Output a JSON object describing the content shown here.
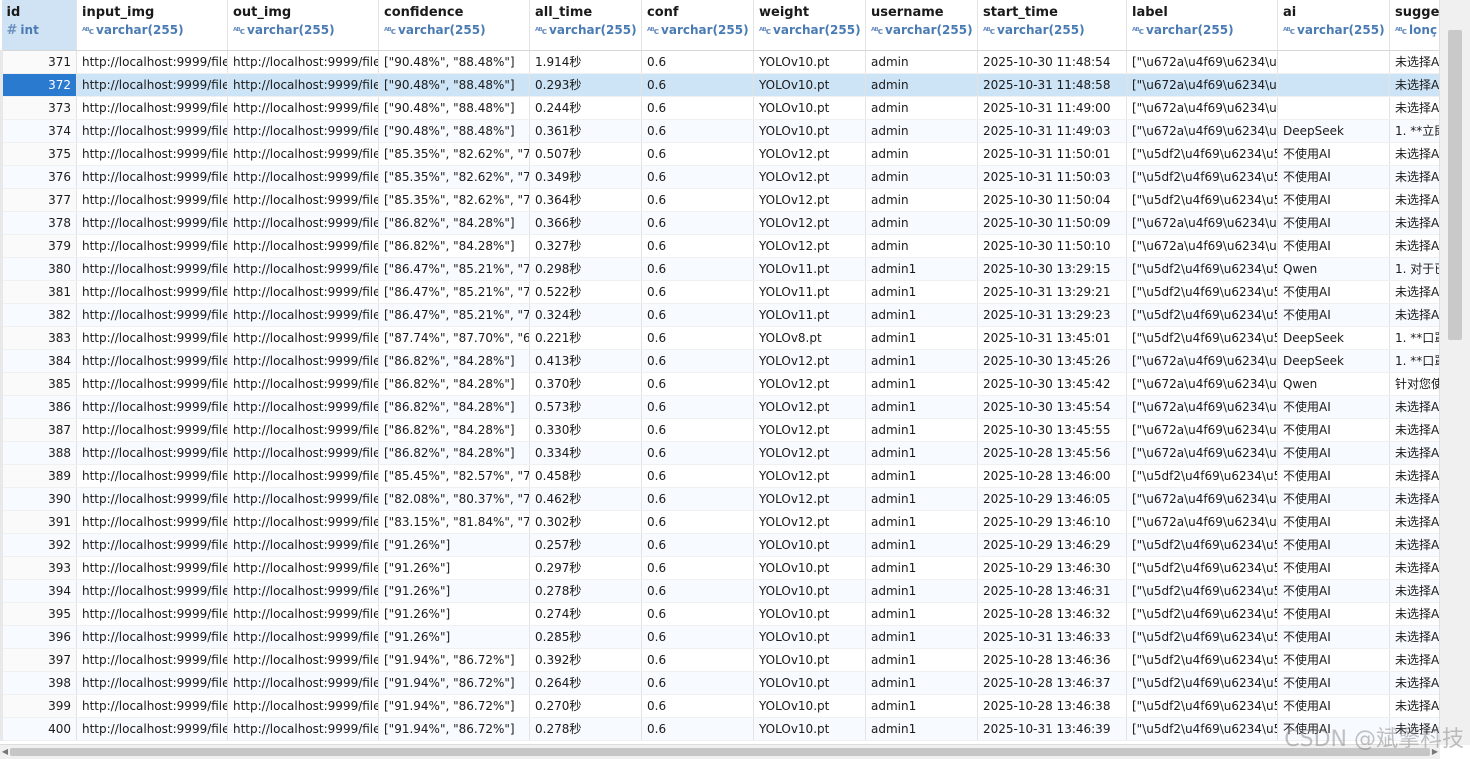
{
  "columns": [
    {
      "name": "id",
      "type": "int",
      "icon": "number-type-icon"
    },
    {
      "name": "input_img",
      "type": "",
      "icon": ""
    },
    {
      "name": "out_img",
      "type": "varchar(255)",
      "icon": "text-type-icon"
    },
    {
      "name": "confidence",
      "type": "varchar(255)",
      "icon": "text-type-icon"
    },
    {
      "name": "all_time",
      "type": "varchar(255)",
      "icon": "text-type-icon"
    },
    {
      "name": "conf",
      "type": "varchar(255)",
      "icon": "text-type-icon"
    },
    {
      "name": "weight",
      "type": "varchar(255)",
      "icon": "text-type-icon"
    },
    {
      "name": "username",
      "type": "varchar(255)",
      "icon": "text-type-icon"
    },
    {
      "name": "start_time",
      "type": "varchar(255)",
      "icon": "text-type-icon"
    },
    {
      "name": "label",
      "type": "varchar(255)",
      "icon": "text-type-icon"
    },
    {
      "name": "ai",
      "type": "varchar(255)",
      "icon": "text-type-icon"
    },
    {
      "name": "sugge",
      "type": "lonç",
      "icon": "text-type-icon"
    }
  ],
  "input_img_type": "varchar(255)",
  "rows": [
    [
      "371",
      "http://localhost:9999/file",
      "http://localhost:9999/file",
      "[\"90.48%\", \"88.48%\"]",
      "1.914秒",
      "0.6",
      "YOLOv10.pt",
      "admin",
      "2025-10-30 11:48:54",
      "[\"\\u672a\\u4f69\\u6234\\u5",
      "",
      "未选择A"
    ],
    [
      "372",
      "http://localhost:9999/file",
      "http://localhost:9999/file",
      "[\"90.48%\", \"88.48%\"]",
      "0.293秒",
      "0.6",
      "YOLOv10.pt",
      "admin",
      "2025-10-31 11:48:58",
      "[\"\\u672a\\u4f69\\u6234\\u5",
      "",
      "未选择A"
    ],
    [
      "373",
      "http://localhost:9999/file",
      "http://localhost:9999/file",
      "[\"90.48%\", \"88.48%\"]",
      "0.244秒",
      "0.6",
      "YOLOv10.pt",
      "admin",
      "2025-10-31 11:49:00",
      "[\"\\u672a\\u4f69\\u6234\\u5",
      "",
      "未选择A"
    ],
    [
      "374",
      "http://localhost:9999/file",
      "http://localhost:9999/file",
      "[\"90.48%\", \"88.48%\"]",
      "0.361秒",
      "0.6",
      "YOLOv10.pt",
      "admin",
      "2025-10-31 11:49:03",
      "[\"\\u672a\\u4f69\\u6234\\u5",
      "DeepSeek",
      "1. **立即"
    ],
    [
      "375",
      "http://localhost:9999/file",
      "http://localhost:9999/file",
      "[\"85.35%\", \"82.62%\", \"71",
      "0.507秒",
      "0.6",
      "YOLOv12.pt",
      "admin",
      "2025-10-31 11:50:01",
      "[\"\\u5df2\\u4f69\\u6234\\u5",
      "不使用AI",
      "未选择A"
    ],
    [
      "376",
      "http://localhost:9999/file",
      "http://localhost:9999/file",
      "[\"85.35%\", \"82.62%\", \"71",
      "0.349秒",
      "0.6",
      "YOLOv12.pt",
      "admin",
      "2025-10-31 11:50:03",
      "[\"\\u5df2\\u4f69\\u6234\\u5",
      "不使用AI",
      "未选择A"
    ],
    [
      "377",
      "http://localhost:9999/file",
      "http://localhost:9999/file",
      "[\"85.35%\", \"82.62%\", \"71",
      "0.364秒",
      "0.6",
      "YOLOv12.pt",
      "admin",
      "2025-10-30 11:50:04",
      "[\"\\u5df2\\u4f69\\u6234\\u5",
      "不使用AI",
      "未选择A"
    ],
    [
      "378",
      "http://localhost:9999/file",
      "http://localhost:9999/file",
      "[\"86.82%\", \"84.28%\"]",
      "0.366秒",
      "0.6",
      "YOLOv12.pt",
      "admin",
      "2025-10-30 11:50:09",
      "[\"\\u672a\\u4f69\\u6234\\u5",
      "不使用AI",
      "未选择A"
    ],
    [
      "379",
      "http://localhost:9999/file",
      "http://localhost:9999/file",
      "[\"86.82%\", \"84.28%\"]",
      "0.327秒",
      "0.6",
      "YOLOv12.pt",
      "admin",
      "2025-10-30 11:50:10",
      "[\"\\u672a\\u4f69\\u6234\\u5",
      "不使用AI",
      "未选择A"
    ],
    [
      "380",
      "http://localhost:9999/file",
      "http://localhost:9999/file",
      "[\"86.47%\", \"85.21%\", \"78",
      "0.298秒",
      "0.6",
      "YOLOv11.pt",
      "admin1",
      "2025-10-30 13:29:15",
      "[\"\\u5df2\\u4f69\\u6234\\u5",
      "Qwen",
      "1. 对于已"
    ],
    [
      "381",
      "http://localhost:9999/file",
      "http://localhost:9999/file",
      "[\"86.47%\", \"85.21%\", \"78",
      "0.522秒",
      "0.6",
      "YOLOv11.pt",
      "admin1",
      "2025-10-31 13:29:21",
      "[\"\\u5df2\\u4f69\\u6234\\u5",
      "不使用AI",
      "未选择A"
    ],
    [
      "382",
      "http://localhost:9999/file",
      "http://localhost:9999/file",
      "[\"86.47%\", \"85.21%\", \"78",
      "0.324秒",
      "0.6",
      "YOLOv11.pt",
      "admin1",
      "2025-10-31 13:29:23",
      "[\"\\u5df2\\u4f69\\u6234\\u5",
      "不使用AI",
      "未选择A"
    ],
    [
      "383",
      "http://localhost:9999/file",
      "http://localhost:9999/file",
      "[\"87.74%\", \"87.70%\", \"60",
      "0.221秒",
      "0.6",
      "YOLOv8.pt",
      "admin1",
      "2025-10-31 13:45:01",
      "[\"\\u5df2\\u4f69\\u6234\\u5",
      "DeepSeek",
      "1. **口罩"
    ],
    [
      "384",
      "http://localhost:9999/file",
      "http://localhost:9999/file",
      "[\"86.82%\", \"84.28%\"]",
      "0.413秒",
      "0.6",
      "YOLOv12.pt",
      "admin1",
      "2025-10-30 13:45:26",
      "[\"\\u672a\\u4f69\\u6234\\u5",
      "DeepSeek",
      "1. **口罩"
    ],
    [
      "385",
      "http://localhost:9999/file",
      "http://localhost:9999/file",
      "[\"86.82%\", \"84.28%\"]",
      "0.370秒",
      "0.6",
      "YOLOv12.pt",
      "admin1",
      "2025-10-30 13:45:42",
      "[\"\\u672a\\u4f69\\u6234\\u5",
      "Qwen",
      "针对您使"
    ],
    [
      "386",
      "http://localhost:9999/file",
      "http://localhost:9999/file",
      "[\"86.82%\", \"84.28%\"]",
      "0.573秒",
      "0.6",
      "YOLOv12.pt",
      "admin1",
      "2025-10-30 13:45:54",
      "[\"\\u672a\\u4f69\\u6234\\u5",
      "不使用AI",
      "未选择A"
    ],
    [
      "387",
      "http://localhost:9999/file",
      "http://localhost:9999/file",
      "[\"86.82%\", \"84.28%\"]",
      "0.330秒",
      "0.6",
      "YOLOv12.pt",
      "admin1",
      "2025-10-30 13:45:55",
      "[\"\\u672a\\u4f69\\u6234\\u5",
      "不使用AI",
      "未选择A"
    ],
    [
      "388",
      "http://localhost:9999/file",
      "http://localhost:9999/file",
      "[\"86.82%\", \"84.28%\"]",
      "0.334秒",
      "0.6",
      "YOLOv12.pt",
      "admin1",
      "2025-10-28 13:45:56",
      "[\"\\u672a\\u4f69\\u6234\\u5",
      "不使用AI",
      "未选择A"
    ],
    [
      "389",
      "http://localhost:9999/file",
      "http://localhost:9999/file",
      "[\"85.45%\", \"82.57%\", \"77",
      "0.458秒",
      "0.6",
      "YOLOv12.pt",
      "admin1",
      "2025-10-28 13:46:00",
      "[\"\\u5df2\\u4f69\\u6234\\u5",
      "不使用AI",
      "未选择A"
    ],
    [
      "390",
      "http://localhost:9999/file",
      "http://localhost:9999/file",
      "[\"82.08%\", \"80.37%\", \"73",
      "0.462秒",
      "0.6",
      "YOLOv12.pt",
      "admin1",
      "2025-10-29 13:46:05",
      "[\"\\u672a\\u4f69\\u6234\\u5",
      "不使用AI",
      "未选择A"
    ],
    [
      "391",
      "http://localhost:9999/file",
      "http://localhost:9999/file",
      "[\"83.15%\", \"81.84%\", \"76",
      "0.302秒",
      "0.6",
      "YOLOv12.pt",
      "admin1",
      "2025-10-29 13:46:10",
      "[\"\\u672a\\u4f69\\u6234\\u5",
      "不使用AI",
      "未选择A"
    ],
    [
      "392",
      "http://localhost:9999/file",
      "http://localhost:9999/file",
      "[\"91.26%\"]",
      "0.257秒",
      "0.6",
      "YOLOv10.pt",
      "admin1",
      "2025-10-29 13:46:29",
      "[\"\\u5df2\\u4f69\\u6234\\u5",
      "不使用AI",
      "未选择A"
    ],
    [
      "393",
      "http://localhost:9999/file",
      "http://localhost:9999/file",
      "[\"91.26%\"]",
      "0.297秒",
      "0.6",
      "YOLOv10.pt",
      "admin1",
      "2025-10-29 13:46:30",
      "[\"\\u5df2\\u4f69\\u6234\\u5",
      "不使用AI",
      "未选择A"
    ],
    [
      "394",
      "http://localhost:9999/file",
      "http://localhost:9999/file",
      "[\"91.26%\"]",
      "0.278秒",
      "0.6",
      "YOLOv10.pt",
      "admin1",
      "2025-10-28 13:46:31",
      "[\"\\u5df2\\u4f69\\u6234\\u5",
      "不使用AI",
      "未选择A"
    ],
    [
      "395",
      "http://localhost:9999/file",
      "http://localhost:9999/file",
      "[\"91.26%\"]",
      "0.274秒",
      "0.6",
      "YOLOv10.pt",
      "admin1",
      "2025-10-28 13:46:32",
      "[\"\\u5df2\\u4f69\\u6234\\u5",
      "不使用AI",
      "未选择A"
    ],
    [
      "396",
      "http://localhost:9999/file",
      "http://localhost:9999/file",
      "[\"91.26%\"]",
      "0.285秒",
      "0.6",
      "YOLOv10.pt",
      "admin1",
      "2025-10-31 13:46:33",
      "[\"\\u5df2\\u4f69\\u6234\\u5",
      "不使用AI",
      "未选择A"
    ],
    [
      "397",
      "http://localhost:9999/file",
      "http://localhost:9999/file",
      "[\"91.94%\", \"86.72%\"]",
      "0.392秒",
      "0.6",
      "YOLOv10.pt",
      "admin1",
      "2025-10-28 13:46:36",
      "[\"\\u5df2\\u4f69\\u6234\\u5",
      "不使用AI",
      "未选择A"
    ],
    [
      "398",
      "http://localhost:9999/file",
      "http://localhost:9999/file",
      "[\"91.94%\", \"86.72%\"]",
      "0.264秒",
      "0.6",
      "YOLOv10.pt",
      "admin1",
      "2025-10-28 13:46:37",
      "[\"\\u5df2\\u4f69\\u6234\\u5",
      "不使用AI",
      "未选择A"
    ],
    [
      "399",
      "http://localhost:9999/file",
      "http://localhost:9999/file",
      "[\"91.94%\", \"86.72%\"]",
      "0.270秒",
      "0.6",
      "YOLOv10.pt",
      "admin1",
      "2025-10-28 13:46:38",
      "[\"\\u5df2\\u4f69\\u6234\\u5",
      "不使用AI",
      "未选择A"
    ],
    [
      "400",
      "http://localhost:9999/file",
      "http://localhost:9999/file",
      "[\"91.94%\", \"86.72%\"]",
      "0.278秒",
      "0.6",
      "YOLOv10.pt",
      "admin1",
      "2025-10-31 13:46:39",
      "[\"\\u5df2\\u4f69\\u6234\\u5",
      "不使用AI",
      "未选择A"
    ]
  ],
  "selected_row_index": 1,
  "watermark": "CSDN @斌擎科技",
  "colors": {
    "selection": "#cde4f7",
    "selected_id": "#2a7ad0",
    "header_id": "#cfe3f5",
    "type_text": "#4a7bb3"
  }
}
